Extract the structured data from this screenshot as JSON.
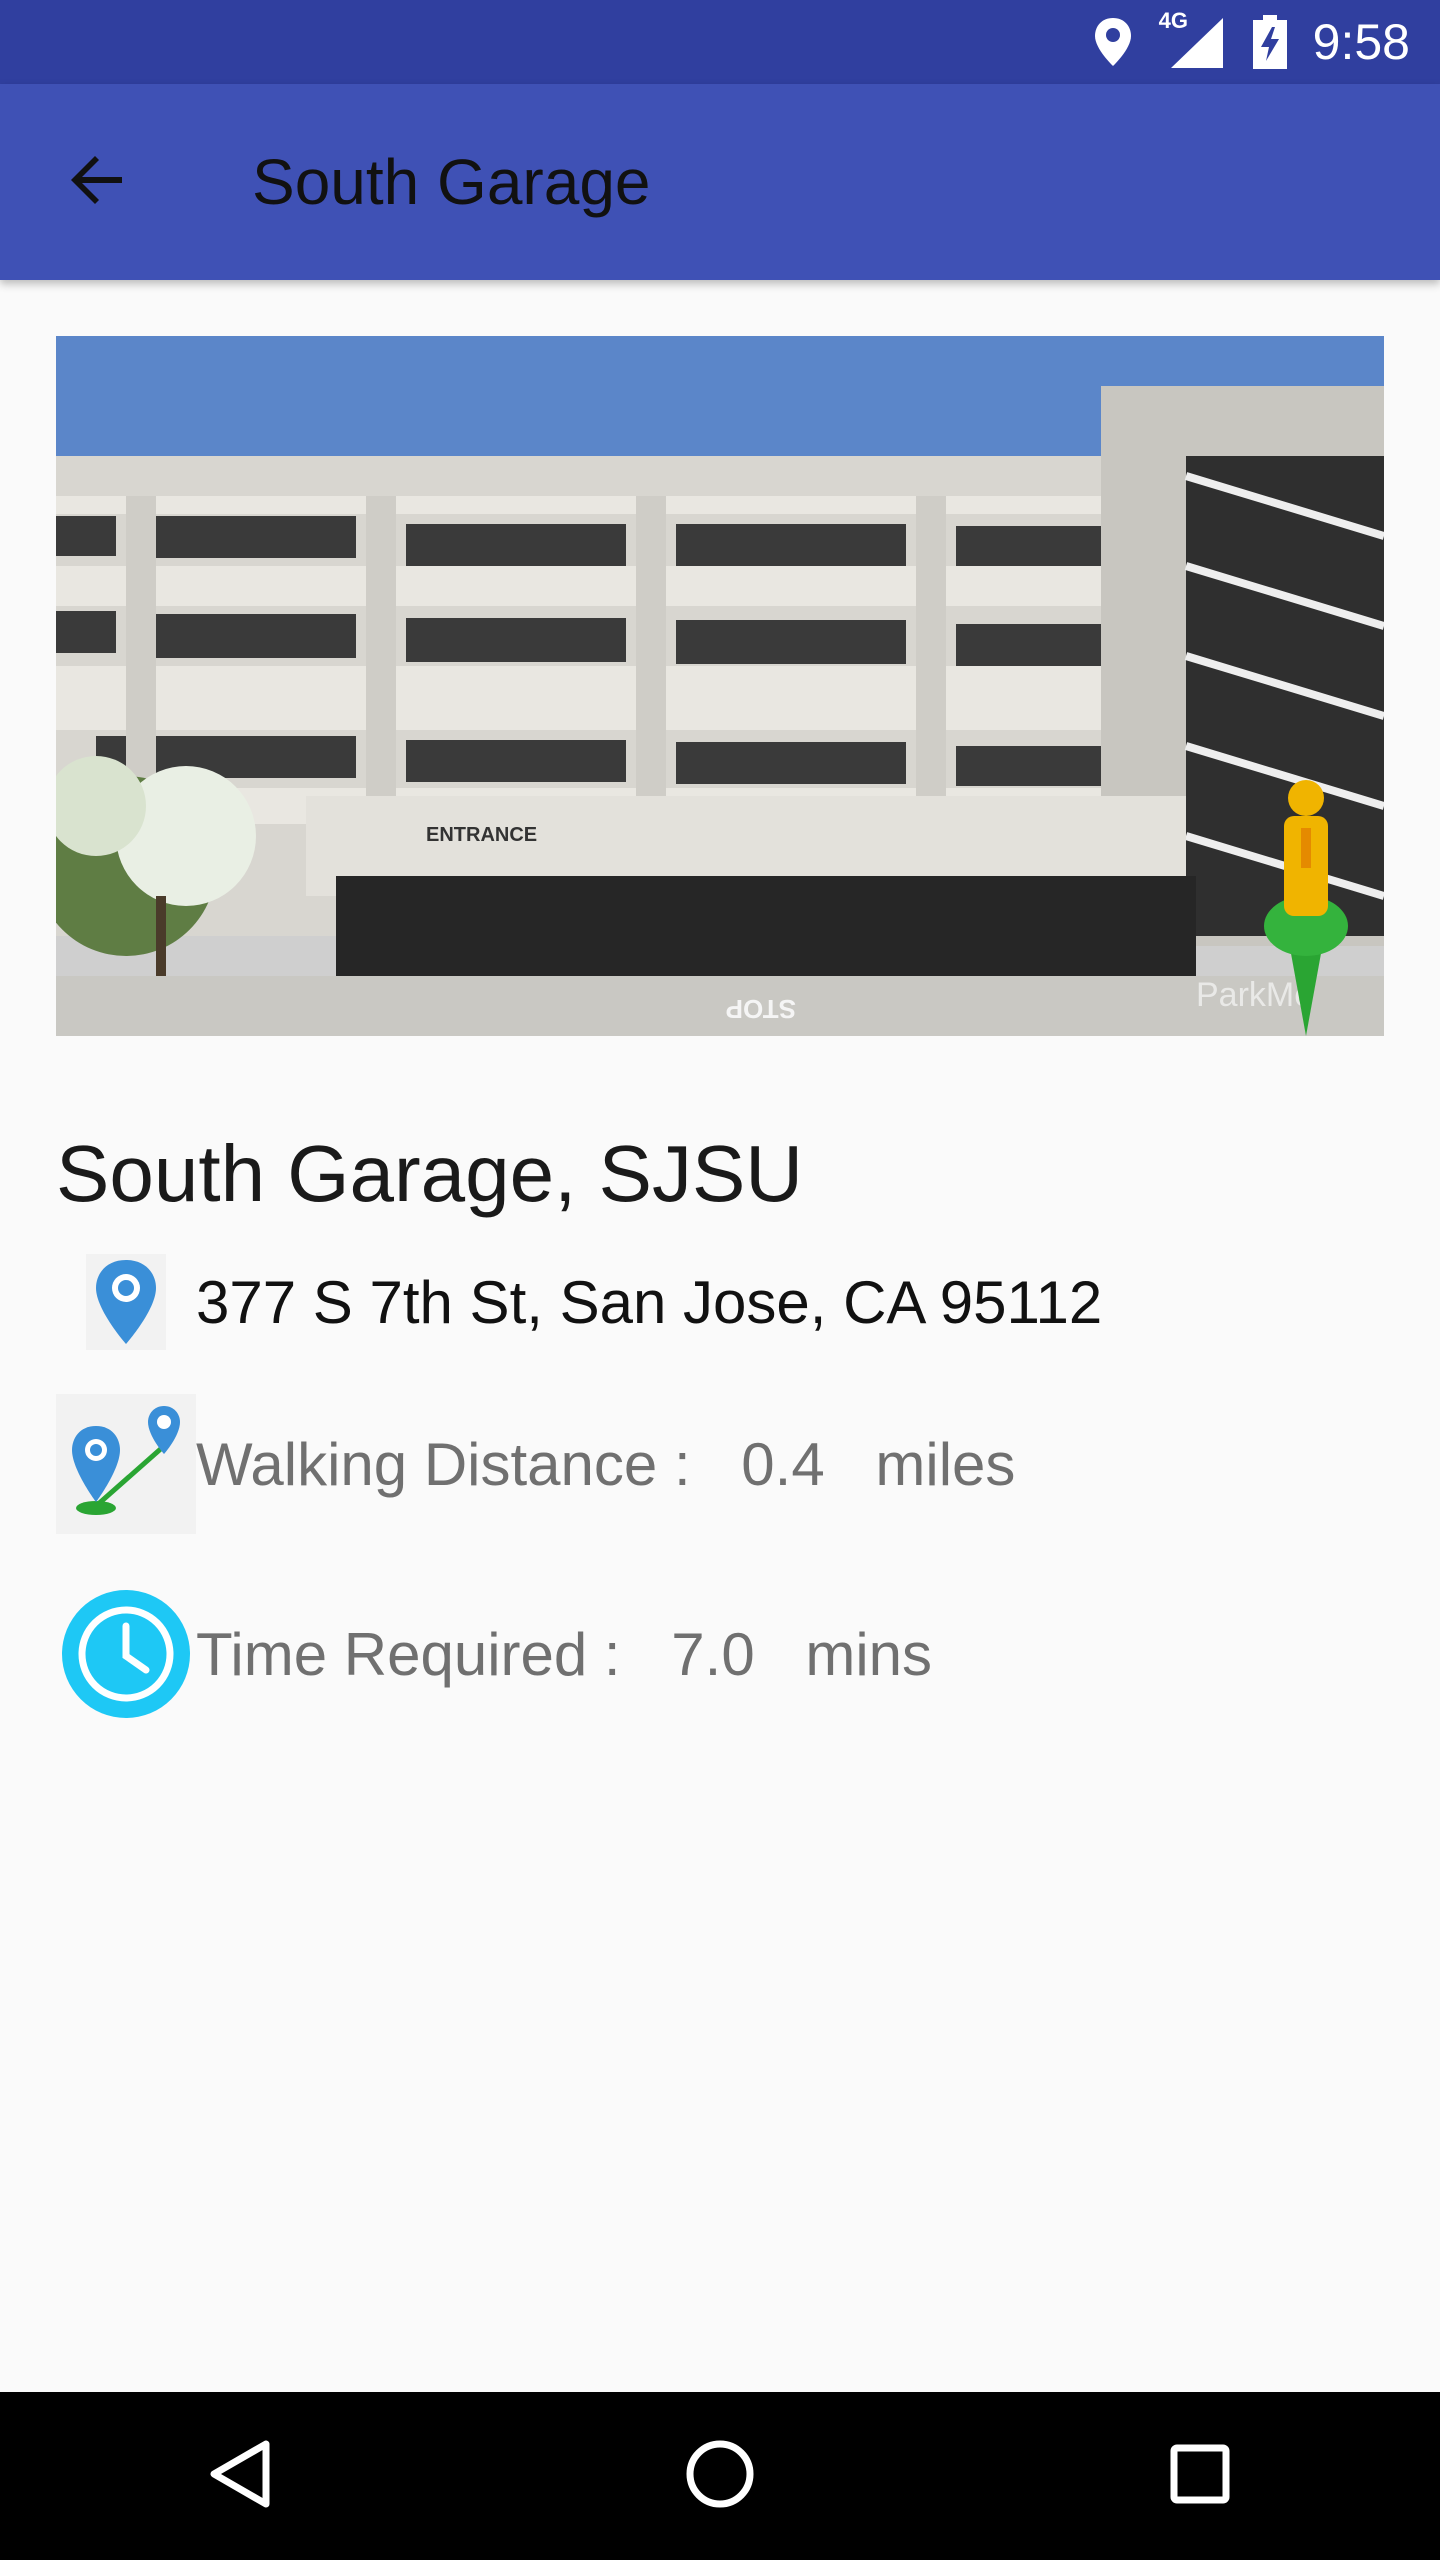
{
  "status_bar": {
    "network": "4G",
    "time": "9:58"
  },
  "app_bar": {
    "title": "South Garage",
    "back_icon": "arrow-back-icon"
  },
  "hero_image": {
    "entrance_sign": "ENTRANCE",
    "ground_text": "STOP",
    "watermark": "ParkMe"
  },
  "details": {
    "name": "South Garage, SJSU",
    "address": "377 S 7th St, San Jose, CA 95112",
    "walking_label": "Walking Distance :",
    "walking_value": "0.4",
    "walking_unit": "miles",
    "time_label": "Time Required :",
    "time_value": "7.0",
    "time_unit": "mins"
  },
  "colors": {
    "status_bar": "#303f9f",
    "app_bar": "#3f51b5",
    "pin_blue": "#3a8fd8",
    "clock_cyan": "#1ec8f5",
    "nav_bar": "#000000"
  },
  "icons": {
    "address": "location-pin-icon",
    "walking": "route-pins-icon",
    "time": "clock-icon"
  },
  "nav": {
    "back": "nav-back-icon",
    "home": "nav-home-icon",
    "recents": "nav-recents-icon"
  }
}
